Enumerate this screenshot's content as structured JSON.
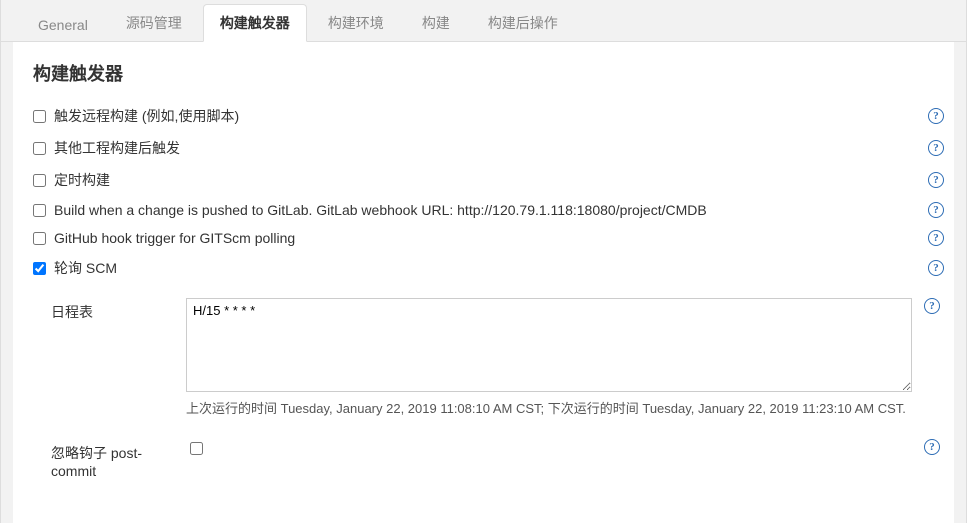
{
  "tabs": [
    {
      "id": "general",
      "label": "General",
      "active": false
    },
    {
      "id": "scm",
      "label": "源码管理",
      "active": false
    },
    {
      "id": "triggers",
      "label": "构建触发器",
      "active": true
    },
    {
      "id": "env",
      "label": "构建环境",
      "active": false
    },
    {
      "id": "build",
      "label": "构建",
      "active": false
    },
    {
      "id": "post",
      "label": "构建后操作",
      "active": false
    }
  ],
  "section_title": "构建触发器",
  "options": [
    {
      "id": "remote",
      "label": "触发远程构建 (例如,使用脚本)",
      "checked": false
    },
    {
      "id": "afterother",
      "label": "其他工程构建后触发",
      "checked": false
    },
    {
      "id": "timer",
      "label": "定时构建",
      "checked": false
    },
    {
      "id": "gitlab",
      "label": "Build when a change is pushed to GitLab. GitLab webhook URL: http://120.79.1.118:18080/project/CMDB",
      "checked": false
    },
    {
      "id": "github",
      "label": "GitHub hook trigger for GITScm polling",
      "checked": false
    },
    {
      "id": "pollscm",
      "label": "轮询 SCM",
      "checked": true
    }
  ],
  "schedule": {
    "label": "日程表",
    "value": "H/15 * * * *",
    "hint": "上次运行的时间 Tuesday, January 22, 2019 11:08:10 AM CST; 下次运行的时间 Tuesday, January 22, 2019 11:23:10 AM CST."
  },
  "ignore_hook": {
    "label": "忽略钩子 post-commit",
    "checked": false
  },
  "help_glyph": "?"
}
